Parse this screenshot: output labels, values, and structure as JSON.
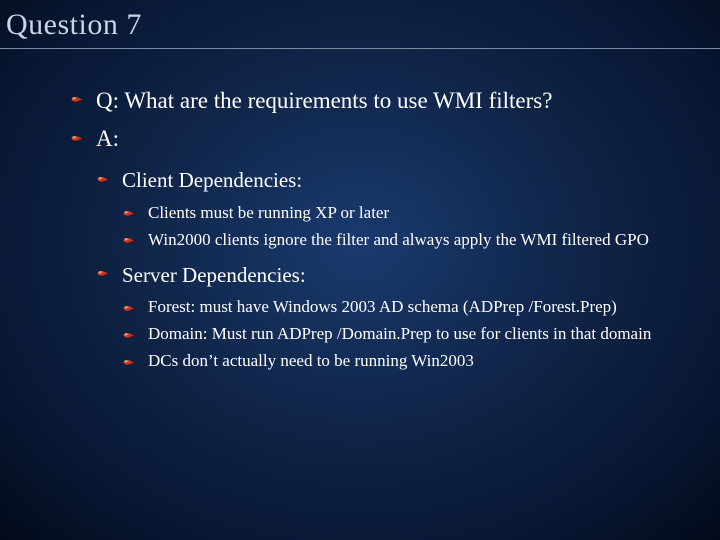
{
  "title": "Question 7",
  "q": "Q: What are the requirements to use WMI filters?",
  "a": "A:",
  "client_dep_label": "Client Dependencies:",
  "client_dep": {
    "item1": "Clients must be running XP or later",
    "item2": "Win2000 clients ignore the filter and always apply the WMI filtered GPO"
  },
  "server_dep_label": "Server Dependencies:",
  "server_dep": {
    "item1": "Forest: must have Windows 2003 AD schema (ADPrep /Forest.Prep)",
    "item2": "Domain: Must run ADPrep /Domain.Prep to use for clients in that domain",
    "item3": "DCs don’t actually need to be running Win2003"
  }
}
